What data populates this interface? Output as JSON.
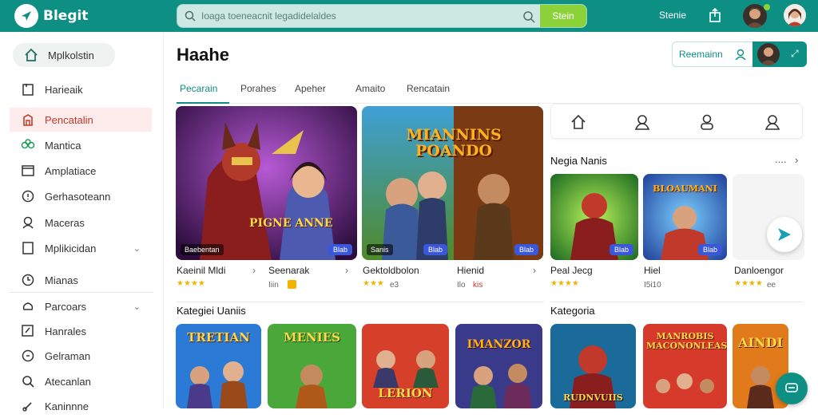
{
  "header": {
    "app_name": "Blegit",
    "search_placeholder": "Ioaga toeneacnit legadidelaldes",
    "search_button": "Stein",
    "top_link": "Stenie"
  },
  "sidebar": {
    "items": [
      {
        "label": "Mplkolstin",
        "icon": "home-icon"
      },
      {
        "label": "Harieaik",
        "icon": "bookmark-icon"
      },
      {
        "label": "Pencatalin",
        "icon": "fire-icon"
      },
      {
        "label": "Mantica",
        "icon": "controller-icon"
      },
      {
        "label": "Amplatiace",
        "icon": "mail-icon"
      },
      {
        "label": "Gerhasoteann",
        "icon": "shield-icon"
      },
      {
        "label": "Maceras",
        "icon": "person-icon"
      },
      {
        "label": "Mplikicidan",
        "icon": "document-icon"
      },
      {
        "label": "Mianas",
        "icon": "clock-icon"
      },
      {
        "label": "Parcoars",
        "icon": "cloud-icon"
      },
      {
        "label": "Hanrales",
        "icon": "edit-icon"
      },
      {
        "label": "Gelraman",
        "icon": "chat-icon"
      },
      {
        "label": "Atecanlan",
        "icon": "search-icon"
      },
      {
        "label": "Kaninnne",
        "icon": "link-icon"
      }
    ]
  },
  "main": {
    "title": "Haahe",
    "tabs": [
      "Pecarain",
      "Porahes",
      "Apeher",
      "Amaito",
      "Rencatain"
    ],
    "right_button": "Reemainn",
    "featured": [
      {
        "title": "Kaeinil Mldi",
        "rating": "★★★★",
        "chip": "Baebentan",
        "badge": "Blab",
        "art": "PIGNE ANNE"
      },
      {
        "title": "Seenarak",
        "sub": "Iiin",
        "badge": "Blab",
        "chip": "",
        "art": ""
      },
      {
        "title": "Gektoldbolon",
        "rating": "★★★",
        "sub": "e3",
        "chip": "Sanis",
        "badge": "Blab",
        "art": "MIANNINS POANDO"
      },
      {
        "title": "Hienid",
        "sub": "Ilo",
        "sub2": "kis",
        "badge": "Blab",
        "chip": "",
        "art": ""
      }
    ],
    "section1": "Kategiei Uaniis",
    "section2": "Kategoria"
  },
  "right_panel": {
    "section_title": "Negia Nanis",
    "more": "....",
    "items": [
      {
        "title": "Peal Jecg",
        "rating": "★★★★",
        "badge": "Blab",
        "art": ""
      },
      {
        "title": "Hiel",
        "sub": "I5i10",
        "badge": "Blab",
        "art": "BLOAUMANI"
      },
      {
        "title": "Danloengor",
        "rating": "★★★★",
        "sub": "ee",
        "badge": "",
        "art": ""
      }
    ]
  },
  "bottom_row": [
    {
      "art": "TRETIAN"
    },
    {
      "art": "MENIES"
    },
    {
      "art": "LERION"
    },
    {
      "art": "IMANZOR"
    },
    {
      "art": "RUDNVUIIS"
    },
    {
      "art": "MANROBIS MACONONLEAS"
    },
    {
      "art": "AINDI"
    }
  ]
}
